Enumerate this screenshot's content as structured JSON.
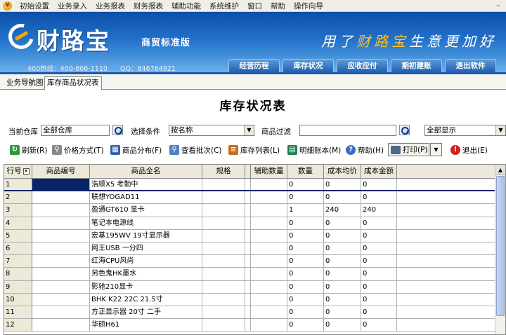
{
  "menubar": {
    "items": [
      "初始设置",
      "业务录入",
      "业务报表",
      "财务报表",
      "辅助功能",
      "系统维护",
      "窗口",
      "帮助",
      "操作向导"
    ],
    "minimize_glyph": "–"
  },
  "banner": {
    "brand": "财路宝",
    "edition": "商贸标准版",
    "slogan_pre": "用了",
    "slogan_brand": "财路宝",
    "slogan_post": "生意更加好",
    "hotline": "400热线：400-806-1110",
    "qq": "QQ：846764921",
    "nav_tabs": [
      "经营历程",
      "库存状况",
      "应收应付",
      "期初建账",
      "退出软件"
    ]
  },
  "doc_tabs": {
    "nav_label": "业务导航图",
    "active_label": "库存商品状况表"
  },
  "report": {
    "title": "库存状况表"
  },
  "filters": {
    "warehouse_label": "当前仓库",
    "warehouse_value": "全部仓库",
    "condition_label": "选择条件",
    "condition_value": "按名称",
    "product_filter_label": "商品过滤",
    "product_filter_value": "",
    "display_value": "全部显示"
  },
  "toolbar": {
    "refresh": "刷新(R)",
    "price_mode": "价格方式(T)",
    "distribution": "商品分布(F)",
    "view_batch": "查看批次(C)",
    "stock_list": "库存列表(L)",
    "detail_ledger": "明细账本(M)",
    "help": "帮助(H)",
    "print": "打印(P)",
    "exit": "退出(E)"
  },
  "grid": {
    "columns": [
      "行号",
      "商品编号",
      "商品全名",
      "规格",
      "",
      "辅助数量",
      "数量",
      "成本均价",
      "成本金额"
    ],
    "rows": [
      {
        "no": "1",
        "code": "",
        "name": "浩顺X5 考勤中",
        "qty": "0",
        "avg": "0",
        "amt": "0"
      },
      {
        "no": "2",
        "code": "",
        "name": "联想YOGAD11",
        "qty": "0",
        "avg": "0",
        "amt": "0"
      },
      {
        "no": "3",
        "code": "",
        "name": "盈通GT610 显卡",
        "qty": "1",
        "avg": "240",
        "amt": "240"
      },
      {
        "no": "4",
        "code": "",
        "name": "笔记本电源线",
        "qty": "0",
        "avg": "0",
        "amt": "0"
      },
      {
        "no": "5",
        "code": "",
        "name": "宏基195WV 19寸显示器",
        "qty": "0",
        "avg": "0",
        "amt": "0"
      },
      {
        "no": "6",
        "code": "",
        "name": "网王USB 一分四",
        "qty": "0",
        "avg": "0",
        "amt": "0"
      },
      {
        "no": "7",
        "code": "",
        "name": "红海CPU风尚",
        "qty": "0",
        "avg": "0",
        "amt": "0"
      },
      {
        "no": "8",
        "code": "",
        "name": "另色鬼HK墨水",
        "qty": "0",
        "avg": "0",
        "amt": "0"
      },
      {
        "no": "9",
        "code": "",
        "name": "影驰210显卡",
        "qty": "0",
        "avg": "0",
        "amt": "0"
      },
      {
        "no": "10",
        "code": "",
        "name": "BHK K22 22C 21.5寸",
        "qty": "0",
        "avg": "0",
        "amt": "0"
      },
      {
        "no": "11",
        "code": "",
        "name": "方正显示器    20寸    二手",
        "qty": "0",
        "avg": "0",
        "amt": "0"
      },
      {
        "no": "12",
        "code": "",
        "name": "华硕H61",
        "qty": "0",
        "avg": "0",
        "amt": "0"
      }
    ]
  }
}
